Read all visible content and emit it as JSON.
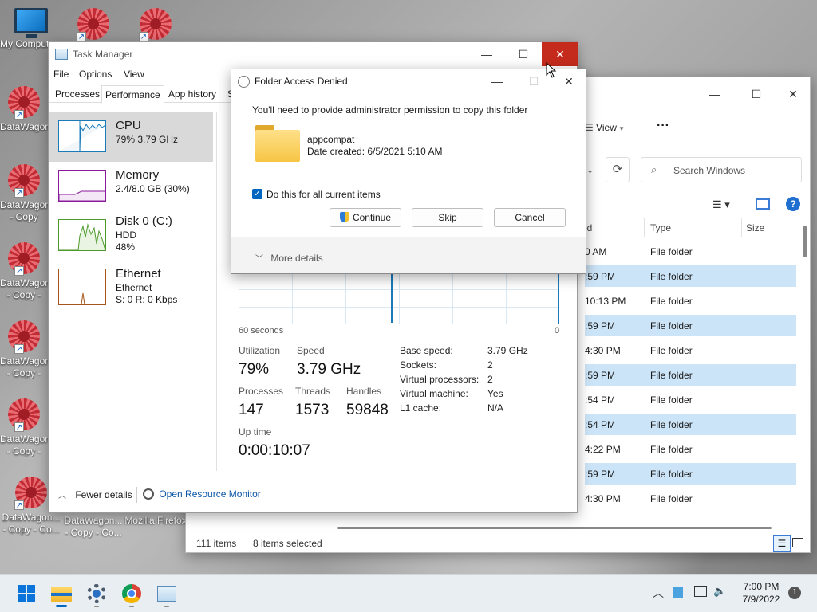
{
  "desktop": {
    "icons": [
      {
        "label": "My Computer",
        "type": "monitor-icon"
      },
      {
        "label": "DataWagon",
        "type": "shortcut-icon"
      },
      {
        "label": "DataWagon - Copy",
        "type": "shortcut-icon"
      },
      {
        "label": "DataWagon - Copy - C...",
        "type": "shortcut-icon"
      },
      {
        "label": "DataWagon - Copy - C...",
        "type": "shortcut-icon"
      },
      {
        "label": "DataWagon - Copy - C...",
        "type": "shortcut-icon"
      },
      {
        "label": "DataWagon... - Copy - Co...",
        "type": "shortcut-icon"
      },
      {
        "label": "DataWagon... - Copy - Co...",
        "type": "shortcut-icon"
      },
      {
        "label": "Mozilla Firefox",
        "type": "shortcut-icon"
      }
    ]
  },
  "explorer": {
    "view_label": "View",
    "more": "···",
    "search_placeholder": "Search Windows",
    "columns": {
      "date": "ed",
      "type": "Type",
      "size": "Size"
    },
    "rows": [
      {
        "date": "0 AM",
        "type": "File folder",
        "selected": false
      },
      {
        "date": ":59 PM",
        "type": "File folder",
        "selected": true
      },
      {
        "date": "10:13 PM",
        "type": "File folder",
        "selected": false
      },
      {
        "date": ":59 PM",
        "type": "File folder",
        "selected": true
      },
      {
        "date": "4:30 PM",
        "type": "File folder",
        "selected": false
      },
      {
        "date": ":59 PM",
        "type": "File folder",
        "selected": true
      },
      {
        "date": ":54 PM",
        "type": "File folder",
        "selected": false
      },
      {
        "date": ":54 PM",
        "type": "File folder",
        "selected": true
      },
      {
        "date": "4:22 PM",
        "type": "File folder",
        "selected": false
      },
      {
        "date": ":59 PM",
        "type": "File folder",
        "selected": true
      },
      {
        "date": "4:30 PM",
        "type": "File folder",
        "selected": false
      }
    ],
    "status_items": "111 items",
    "status_selected": "8 items selected"
  },
  "taskmanager": {
    "title": "Task Manager",
    "menu": [
      "File",
      "Options",
      "View"
    ],
    "tabs": [
      "Processes",
      "Performance",
      "App history",
      "S"
    ],
    "perf_items": [
      {
        "name": "CPU",
        "line1": "79%  3.79 GHz",
        "line2": "",
        "line3": "",
        "color": "#1a7bb8"
      },
      {
        "name": "Memory",
        "line1": "2.4/8.0 GB (30%)",
        "line2": "",
        "line3": "",
        "color": "#8b1a9e"
      },
      {
        "name": "Disk 0 (C:)",
        "line1": "HDD",
        "line2": "48%",
        "line3": "",
        "color": "#4c9a2a"
      },
      {
        "name": "Ethernet",
        "line1": "Ethernet",
        "line2": "S: 0  R: 0 Kbps",
        "line3": "",
        "color": "#a6561a"
      }
    ],
    "graph_left": "60 seconds",
    "graph_right": "0",
    "utilization_label": "Utilization",
    "utilization": "79%",
    "speed_label": "Speed",
    "speed": "3.79 GHz",
    "processes_label": "Processes",
    "processes": "147",
    "threads_label": "Threads",
    "threads": "1573",
    "handles_label": "Handles",
    "handles": "59848",
    "uptime_label": "Up time",
    "uptime": "0:00:10:07",
    "specs": [
      {
        "k": "Base speed:",
        "v": "3.79 GHz"
      },
      {
        "k": "Sockets:",
        "v": "2"
      },
      {
        "k": "Virtual processors:",
        "v": "2"
      },
      {
        "k": "Virtual machine:",
        "v": "Yes"
      },
      {
        "k": "L1 cache:",
        "v": "N/A"
      }
    ],
    "fewer_details": "Fewer details",
    "open_resource_monitor": "Open Resource Monitor"
  },
  "dialog": {
    "title": "Folder Access Denied",
    "message": "You'll need to provide administrator permission to copy this folder",
    "folder_name": "appcompat",
    "date_created": "Date created: 6/5/2021 5:10 AM",
    "checkbox_label": "Do this for all current items",
    "continue": "Continue",
    "skip": "Skip",
    "cancel": "Cancel",
    "more_details": "More details"
  },
  "taskbar": {
    "time": "7:00 PM",
    "date": "7/9/2022",
    "notif_count": "1"
  },
  "colors": {
    "accent": "#0067c0",
    "selection": "#cce4f7",
    "close_red": "#c42b1c"
  }
}
